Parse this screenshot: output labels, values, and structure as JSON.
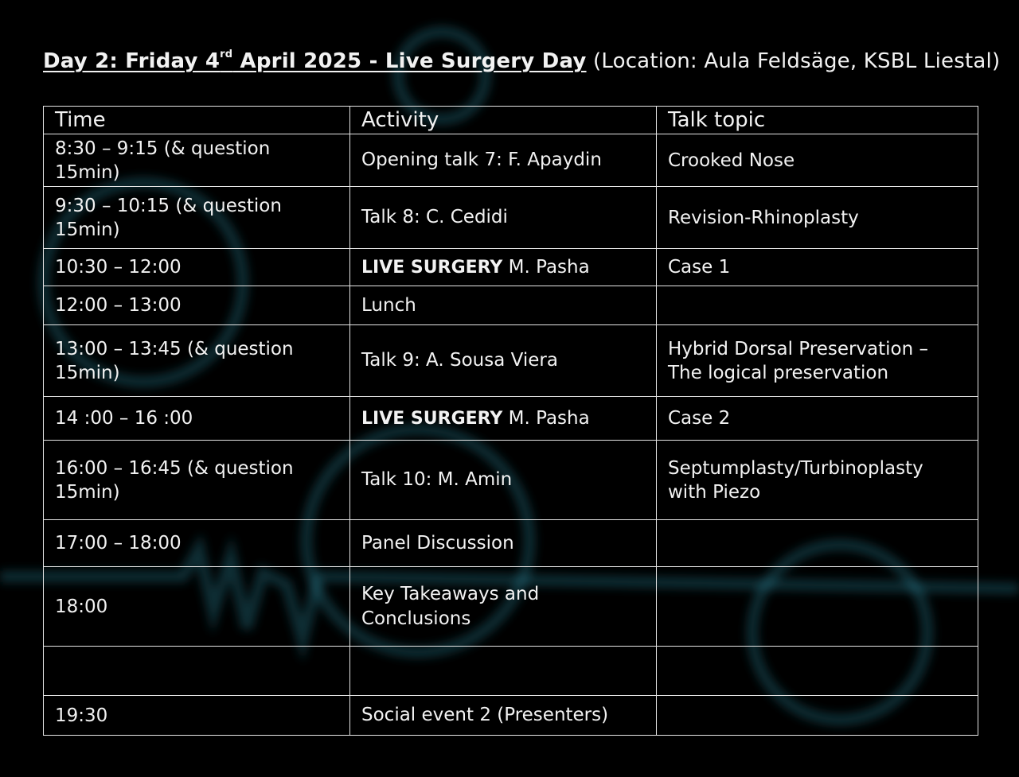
{
  "heading": {
    "day_label": "Day 2: Friday 4",
    "day_sup": "rd",
    "day_rest": " April 2025 - Live Surgery Day",
    "location": " (Location: Aula Feldsäge, KSBL Liestal)"
  },
  "table": {
    "headers": [
      "Time",
      "Activity",
      "Talk topic"
    ],
    "rows": [
      {
        "time": "8:30 – 9:15 (& question 15min)",
        "activity_bold": "",
        "activity": "Opening talk 7: F. Apaydin",
        "topic": "Crooked Nose"
      },
      {
        "time": "9:30 – 10:15 (& question 15min)",
        "activity_bold": "",
        "activity": "Talk 8: C. Cedidi",
        "topic": "Revision-Rhinoplasty"
      },
      {
        "time": "10:30 – 12:00",
        "activity_bold": "LIVE SURGERY",
        "activity": " M. Pasha",
        "topic": "Case 1"
      },
      {
        "time": "12:00 – 13:00",
        "activity_bold": "",
        "activity": "Lunch",
        "topic": ""
      },
      {
        "time": "13:00 – 13:45 (& question 15min)",
        "activity_bold": "",
        "activity": "Talk 9: A. Sousa Viera",
        "topic": "Hybrid Dorsal Preservation – The logical preservation"
      },
      {
        "time": "14 :00 – 16 :00",
        "activity_bold": "LIVE SURGERY",
        "activity": " M. Pasha",
        "topic": "Case 2"
      },
      {
        "time": "16:00 – 16:45 (& question 15min)",
        "activity_bold": "",
        "activity": "Talk 10: M. Amin",
        "topic": "Septumplasty/Turbinoplasty with Piezo"
      },
      {
        "time": "17:00 – 18:00",
        "activity_bold": "",
        "activity": "Panel Discussion",
        "topic": ""
      },
      {
        "time": "18:00",
        "activity_bold": "",
        "activity": "Key Takeaways and Conclusions",
        "topic": ""
      },
      {
        "time": "",
        "activity_bold": "",
        "activity": "",
        "topic": ""
      },
      {
        "time": "19:30",
        "activity_bold": "",
        "activity": "Social event 2 (Presenters)",
        "topic": ""
      }
    ]
  },
  "colors": {
    "background": "#000000",
    "text": "#f2f2f2",
    "border": "#e6e6e6",
    "decor": "#3fa3b8"
  }
}
